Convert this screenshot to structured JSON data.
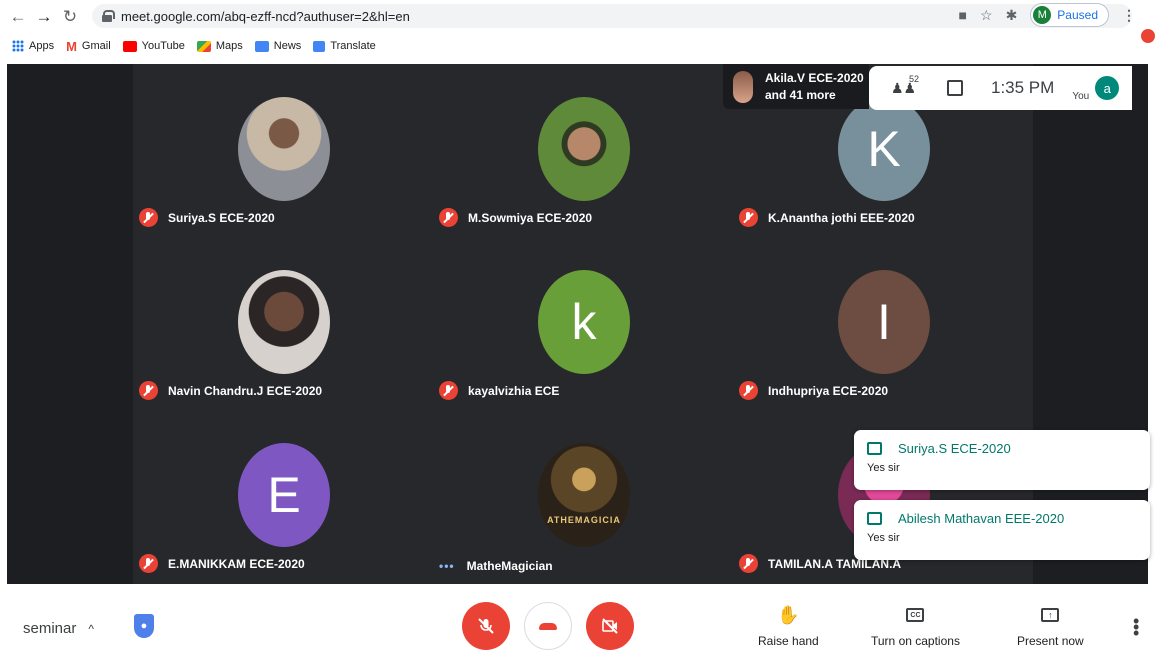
{
  "browser": {
    "url": "meet.google.com/abq-ezff-ncd?authuser=2&hl=en",
    "profile_initial": "M",
    "profile_status": "Paused",
    "bookmarks": [
      "Apps",
      "Gmail",
      "YouTube",
      "Maps",
      "News",
      "Translate"
    ]
  },
  "meeting": {
    "active_speaker": {
      "name": "Akila.V ECE-2020",
      "more": "and 41 more"
    },
    "participant_count": "52",
    "time": "1:35 PM",
    "self_label": "You",
    "self_initial": "a",
    "participants": [
      {
        "name": "Suriya.S ECE-2020",
        "initial": "",
        "color": "#8a7d6e",
        "muted": true
      },
      {
        "name": "M.Sowmiya ECE-2020",
        "initial": "",
        "color": "#4b6b3a",
        "muted": true
      },
      {
        "name": "K.Anantha jothi EEE-2020",
        "initial": "K",
        "color": "#78909c",
        "muted": true
      },
      {
        "name": "Navin Chandru.J ECE-2020",
        "initial": "",
        "color": "#5b4a44",
        "muted": true
      },
      {
        "name": "kayalvizhia ECE",
        "initial": "k",
        "color": "#689f38",
        "muted": true
      },
      {
        "name": "Indhupriya ECE-2020",
        "initial": "I",
        "color": "#6d4c41",
        "muted": true
      },
      {
        "name": "E.MANIKKAM ECE-2020",
        "initial": "E",
        "color": "#7e57c2",
        "muted": true
      },
      {
        "name": "MatheMagician",
        "initial": "",
        "color": "#3e3222",
        "muted": false
      },
      {
        "name": "TAMILAN.A TAMILAN.A",
        "initial": "",
        "color": "#7a2b55",
        "muted": true
      }
    ],
    "avatar_text": "ATHEMAGICIA",
    "chat_toasts": [
      {
        "sender": "Suriya.S ECE-2020",
        "message": "Yes sir"
      },
      {
        "sender": "Abilesh Mathavan EEE-2020",
        "message": "Yes sir"
      }
    ]
  },
  "controls": {
    "meeting_name": "seminar",
    "raise_hand": "Raise hand",
    "captions": "Turn on captions",
    "captions_icon": "CC",
    "present": "Present now"
  }
}
